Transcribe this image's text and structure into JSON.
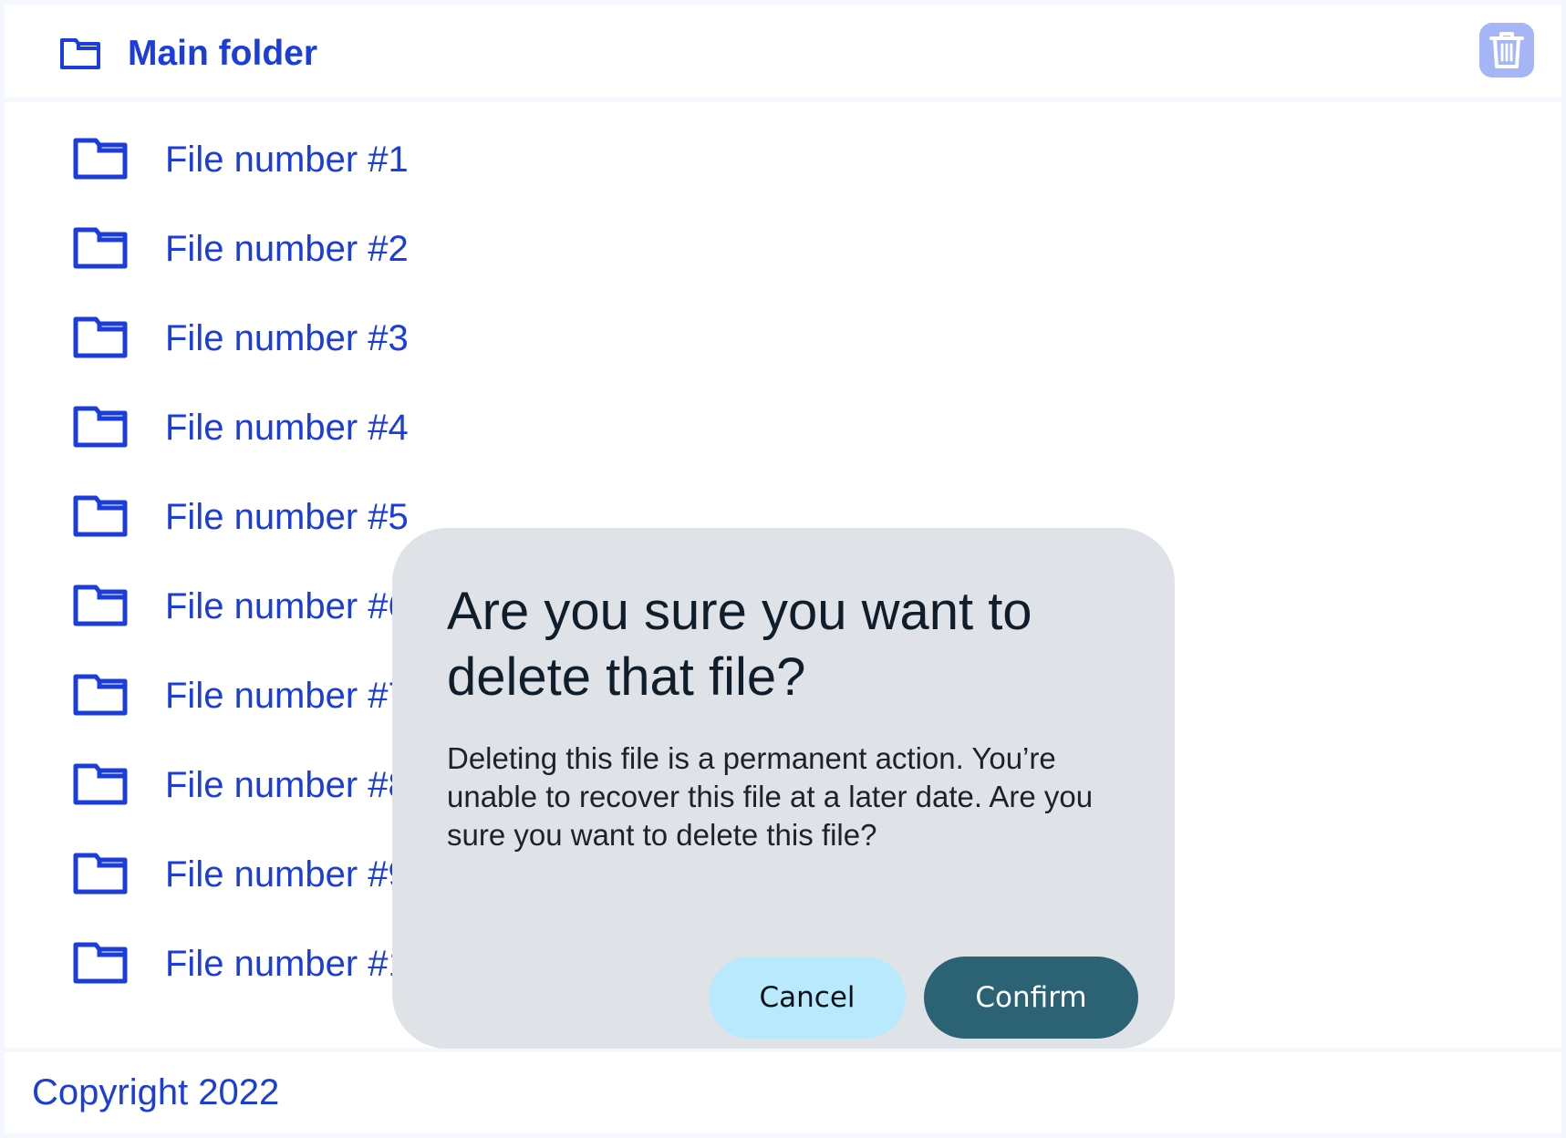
{
  "header": {
    "title": "Main folder",
    "folder_icon": "folder-icon",
    "delete_icon": "trash-icon"
  },
  "files": [
    {
      "label": "File number #1",
      "icon": "folder-icon"
    },
    {
      "label": "File number #2",
      "icon": "folder-icon"
    },
    {
      "label": "File number #3",
      "icon": "folder-icon"
    },
    {
      "label": "File number #4",
      "icon": "folder-icon"
    },
    {
      "label": "File number #5",
      "icon": "folder-icon"
    },
    {
      "label": "File number #6",
      "icon": "folder-icon"
    },
    {
      "label": "File number #7",
      "icon": "folder-icon"
    },
    {
      "label": "File number #8",
      "icon": "folder-icon"
    },
    {
      "label": "File number #9",
      "icon": "folder-icon"
    },
    {
      "label": "File number #10",
      "icon": "folder-icon"
    }
  ],
  "dialog": {
    "title": "Are you sure you want to delete that file?",
    "body": "Deleting this file is a permanent action. You’re unable to recover this file at a later date. Are you sure you want to delete this file?",
    "cancel_label": "Cancel",
    "confirm_label": "Confirm"
  },
  "footer": {
    "text": "Copyright 2022"
  },
  "colors": {
    "accent": "#1a3ddb",
    "page_background": "#f4f7fd",
    "dialog_background": "#dfe3e7",
    "cancel_button": "#b9e9fc",
    "confirm_button": "#2c6374",
    "trash_button": "#a6b5f5"
  }
}
